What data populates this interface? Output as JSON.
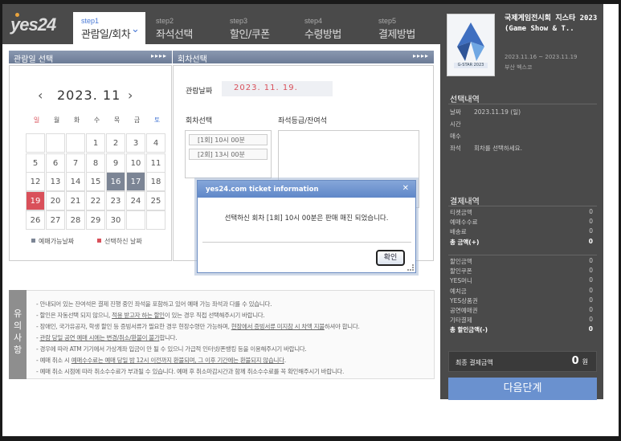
{
  "logo": "yes24",
  "steps": [
    {
      "num": "step1",
      "label": "관람일/회차",
      "active": true
    },
    {
      "num": "step2",
      "label": "좌석선택"
    },
    {
      "num": "step3",
      "label": "할인/쿠폰"
    },
    {
      "num": "step4",
      "label": "수령방법"
    },
    {
      "num": "step5",
      "label": "결제방법"
    }
  ],
  "date_panel": {
    "title": "관람일 선택",
    "arrows": "▸▸▸▸"
  },
  "session_panel": {
    "title": "회차선택",
    "arrows": "▸▸▸▸"
  },
  "calendar": {
    "prev": "‹",
    "next": "›",
    "month": "2023. 11",
    "weekdays": [
      "일",
      "월",
      "화",
      "수",
      "목",
      "금",
      "토"
    ],
    "weeks": [
      [
        "",
        "",
        "",
        "1",
        "2",
        "3",
        "4"
      ],
      [
        "5",
        "6",
        "7",
        "8",
        "9",
        "10",
        "11"
      ],
      [
        "12",
        "13",
        "14",
        "15",
        "16",
        "17",
        "18"
      ],
      [
        "19",
        "20",
        "21",
        "22",
        "23",
        "24",
        "25"
      ],
      [
        "26",
        "27",
        "28",
        "29",
        "30",
        "",
        ""
      ]
    ],
    "available_days": [
      "16",
      "17"
    ],
    "selected_day": "19"
  },
  "legend": {
    "available": "예매가능날짜",
    "selected": "선택하신 날짜"
  },
  "session": {
    "date_label": "관람날짜",
    "date_value": "2023. 11. 19.",
    "session_label": "회차선택",
    "grade_label": "좌석등급/잔여석",
    "items": [
      "[1회] 10시 00분",
      "[2회] 13시 00분"
    ]
  },
  "notes": {
    "tab": [
      "유",
      "의",
      "사",
      "항"
    ],
    "lines": [
      "- 안내되어 있는 잔여석은 결제 진행 중인 좌석을 포함하고 있어 예매 가능 좌석과 다를 수 있습니다.",
      "- 할인은 자동선택 되지 않으니, 적용 받고자 하는 할인이 있는 경우 직접 선택해주시기 바랍니다.",
      "- 장애인, 국가유공자, 학생 할인 등 증빙서류가 필요한 경우 현장수령만 가능하며, 현장에서 증빙서류 미지참 시 차액 지불하셔야 합니다.",
      "- 관람 당일 공연 예매 시에는 변경/취소/환불이 불가합니다.",
      "- 경우에 따라 ATM 기기에서 가상계좌 입금이 안 될 수 있으니 가급적 인터넷/폰뱅킹 등을 이용해주시기 바랍니다.",
      "- 예매 취소 시 예매수수료는 예매 당일 밤 12시 이전까지 환불되며, 그 이후 기간에는 환불되지 않습니다.",
      "- 예매 취소 시점에 따라 취소수수료가 부과될 수 있습니다. 예매 후 취소마감시간과 함께 취소수수료를 꼭 확인해주시기 바랍니다."
    ]
  },
  "show": {
    "title": "국제게임전시회 지스타 2023 (Game Show & T..",
    "dates": "2023.11.16 ~ 2023.11.19",
    "venue": "부산 벡스코",
    "poster_text": "G-STAR 2023"
  },
  "selection": {
    "heading": "선택내역",
    "rows": [
      {
        "k": "날짜",
        "v": "2023.11.19 (일)"
      },
      {
        "k": "시간",
        "v": ""
      },
      {
        "k": "매수",
        "v": ""
      },
      {
        "k": "좌석",
        "v": "회차를 선택하세요."
      }
    ]
  },
  "payment": {
    "heading": "결제내역",
    "group1": [
      {
        "k": "티켓금액",
        "v": "0"
      },
      {
        "k": "예매수수료",
        "v": "0"
      },
      {
        "k": "배송료",
        "v": "0"
      },
      {
        "k": "총 금액(+)",
        "v": "0",
        "bold": true
      }
    ],
    "group2": [
      {
        "k": "할인금액",
        "v": "0"
      },
      {
        "k": "할인쿠폰",
        "v": "0"
      },
      {
        "k": "YES머니",
        "v": "0"
      },
      {
        "k": "예치금",
        "v": "0"
      },
      {
        "k": "YES상품권",
        "v": "0"
      },
      {
        "k": "공연예매권",
        "v": "0"
      },
      {
        "k": "기타결제",
        "v": "0"
      },
      {
        "k": "총 할인금액(-)",
        "v": "0",
        "bold": true
      }
    ],
    "final_label": "최종 결제금액",
    "final_value": "0",
    "final_unit": "원"
  },
  "next_button": "다음단계",
  "modal": {
    "title": "yes24.com ticket information",
    "close": "✕",
    "message": "선택하신 회차 [1회] 10시 00분은 판매 매진 되었습니다.",
    "ok": "확인"
  },
  "colors": {
    "header": "#4a4a4a",
    "accent_red": "#d9505a",
    "accent_blue": "#6a91cf",
    "available": "#7c8595"
  }
}
